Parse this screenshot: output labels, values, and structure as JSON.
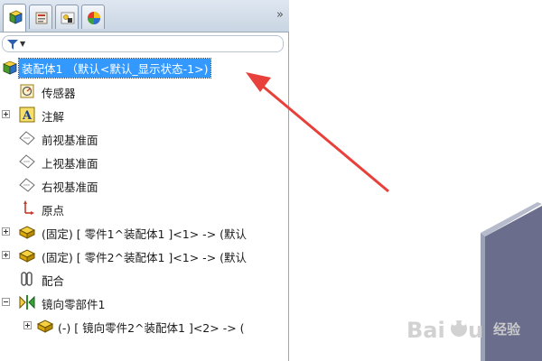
{
  "panel": {
    "tabs": [
      {
        "icon": "feature-manager-icon",
        "active": true
      },
      {
        "icon": "property-manager-icon",
        "active": false
      },
      {
        "icon": "configuration-manager-icon",
        "active": false
      },
      {
        "icon": "display-manager-icon",
        "active": false
      }
    ],
    "tabs_more_label": "»",
    "filter_icon": "filter-icon"
  },
  "tree": {
    "root": {
      "label": "装配体1 （默认<默认_显示状态-1>)",
      "icon": "assembly-icon"
    },
    "items": [
      {
        "label": "传感器",
        "icon": "sensor-icon"
      },
      {
        "label": "注解",
        "icon": "annotation-icon"
      },
      {
        "label": "前视基准面",
        "icon": "plane-icon"
      },
      {
        "label": "上视基准面",
        "icon": "plane-icon"
      },
      {
        "label": "右视基准面",
        "icon": "plane-icon"
      },
      {
        "label": "原点",
        "icon": "origin-icon"
      },
      {
        "label": "(固定) [ 零件1^装配体1 ]<1> -> (默认",
        "icon": "part-icon"
      },
      {
        "label": "(固定) [ 零件2^装配体1 ]<1> -> (默认",
        "icon": "part-icon"
      },
      {
        "label": "配合",
        "icon": "mates-icon"
      },
      {
        "label": "镜向零部件1",
        "icon": "mirror-component-icon"
      },
      {
        "label": "(-) [ 镜向零件2^装配体1 ]<2> -> (",
        "icon": "part-icon"
      }
    ]
  },
  "watermark": {
    "text": "经验"
  },
  "colors": {
    "selection": "#3399ff",
    "arrow": "#e8403a",
    "plate_front": "#6a6e8c",
    "plate_edge": "#9aa3b6"
  }
}
